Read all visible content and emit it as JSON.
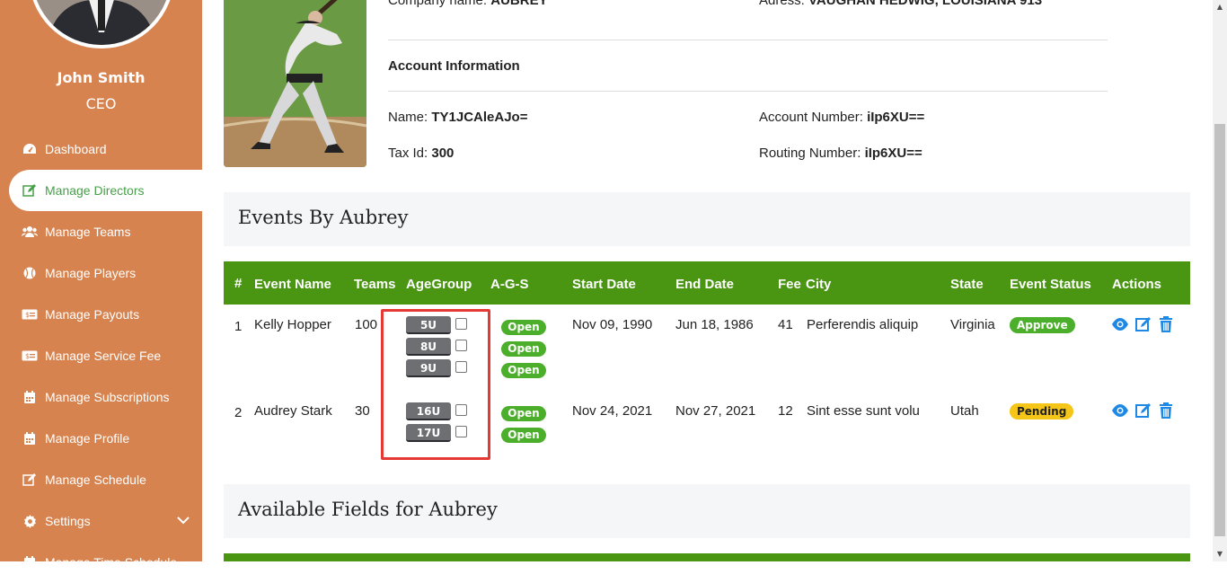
{
  "user": {
    "name": "John Smith",
    "role": "CEO"
  },
  "sidebar": {
    "items": [
      {
        "label": "Dashboard",
        "icon": "dashboard-icon"
      },
      {
        "label": "Manage Directors",
        "icon": "edit-icon",
        "active": true
      },
      {
        "label": "Manage Teams",
        "icon": "users-icon"
      },
      {
        "label": "Manage Players",
        "icon": "baseball-icon"
      },
      {
        "label": "Manage Payouts",
        "icon": "money-icon"
      },
      {
        "label": "Manage Service Fee",
        "icon": "money-icon"
      },
      {
        "label": "Manage Subscriptions",
        "icon": "calendar-icon"
      },
      {
        "label": "Manage Profile",
        "icon": "calendar-icon"
      },
      {
        "label": "Manage Schedule",
        "icon": "edit-icon"
      },
      {
        "label": "Settings",
        "icon": "gear-icon"
      },
      {
        "label": "Manage Time Schedule",
        "icon": "calendar-icon"
      }
    ]
  },
  "profile": {
    "company_label": "Company name: ",
    "company_value": "AUBREY",
    "address_label": "Adress: ",
    "address_value": "VAUGHAN HEDWIG, LOUISIANA 913",
    "account_heading": "Account Information",
    "name_label": "Name: ",
    "name_value": "TY1JCAleAJo=",
    "account_number_label": "Account Number: ",
    "account_number_value": "iIp6XU==",
    "tax_label": "Tax Id: ",
    "tax_value": "300",
    "routing_label": "Routing Number: ",
    "routing_value": "iIp6XU=="
  },
  "events": {
    "title": "Events By Aubrey",
    "headers": [
      "#",
      "Event Name",
      "Teams",
      "AgeGroup",
      "A-G-S",
      "Start Date",
      "End Date",
      "Fee",
      "City",
      "State",
      "Event Status",
      "Actions"
    ],
    "rows": [
      {
        "num": "1",
        "name": "Kelly Hopper",
        "teams": "100",
        "age_groups": [
          "5U",
          "8U",
          "9U"
        ],
        "ags": [
          "Open",
          "Open",
          "Open"
        ],
        "start": "Nov 09, 1990",
        "end": "Jun 18, 1986",
        "fee": "41",
        "city": "Perferendis aliquip",
        "state": "Virginia",
        "status": "Approve"
      },
      {
        "num": "2",
        "name": "Audrey Stark",
        "teams": "30",
        "age_groups": [
          "16U",
          "17U"
        ],
        "ags": [
          "Open",
          "Open"
        ],
        "start": "Nov 24, 2021",
        "end": "Nov 27, 2021",
        "fee": "12",
        "city": "Sint esse sunt volu",
        "state": "Utah",
        "status": "Pending"
      }
    ]
  },
  "fields": {
    "title": "Available Fields for Aubrey"
  },
  "colors": {
    "sidebar": "#d6834f",
    "table_header": "#4a9612",
    "accent_green": "#46a047",
    "highlight": "#e53935",
    "action_blue": "#1e88e5"
  }
}
